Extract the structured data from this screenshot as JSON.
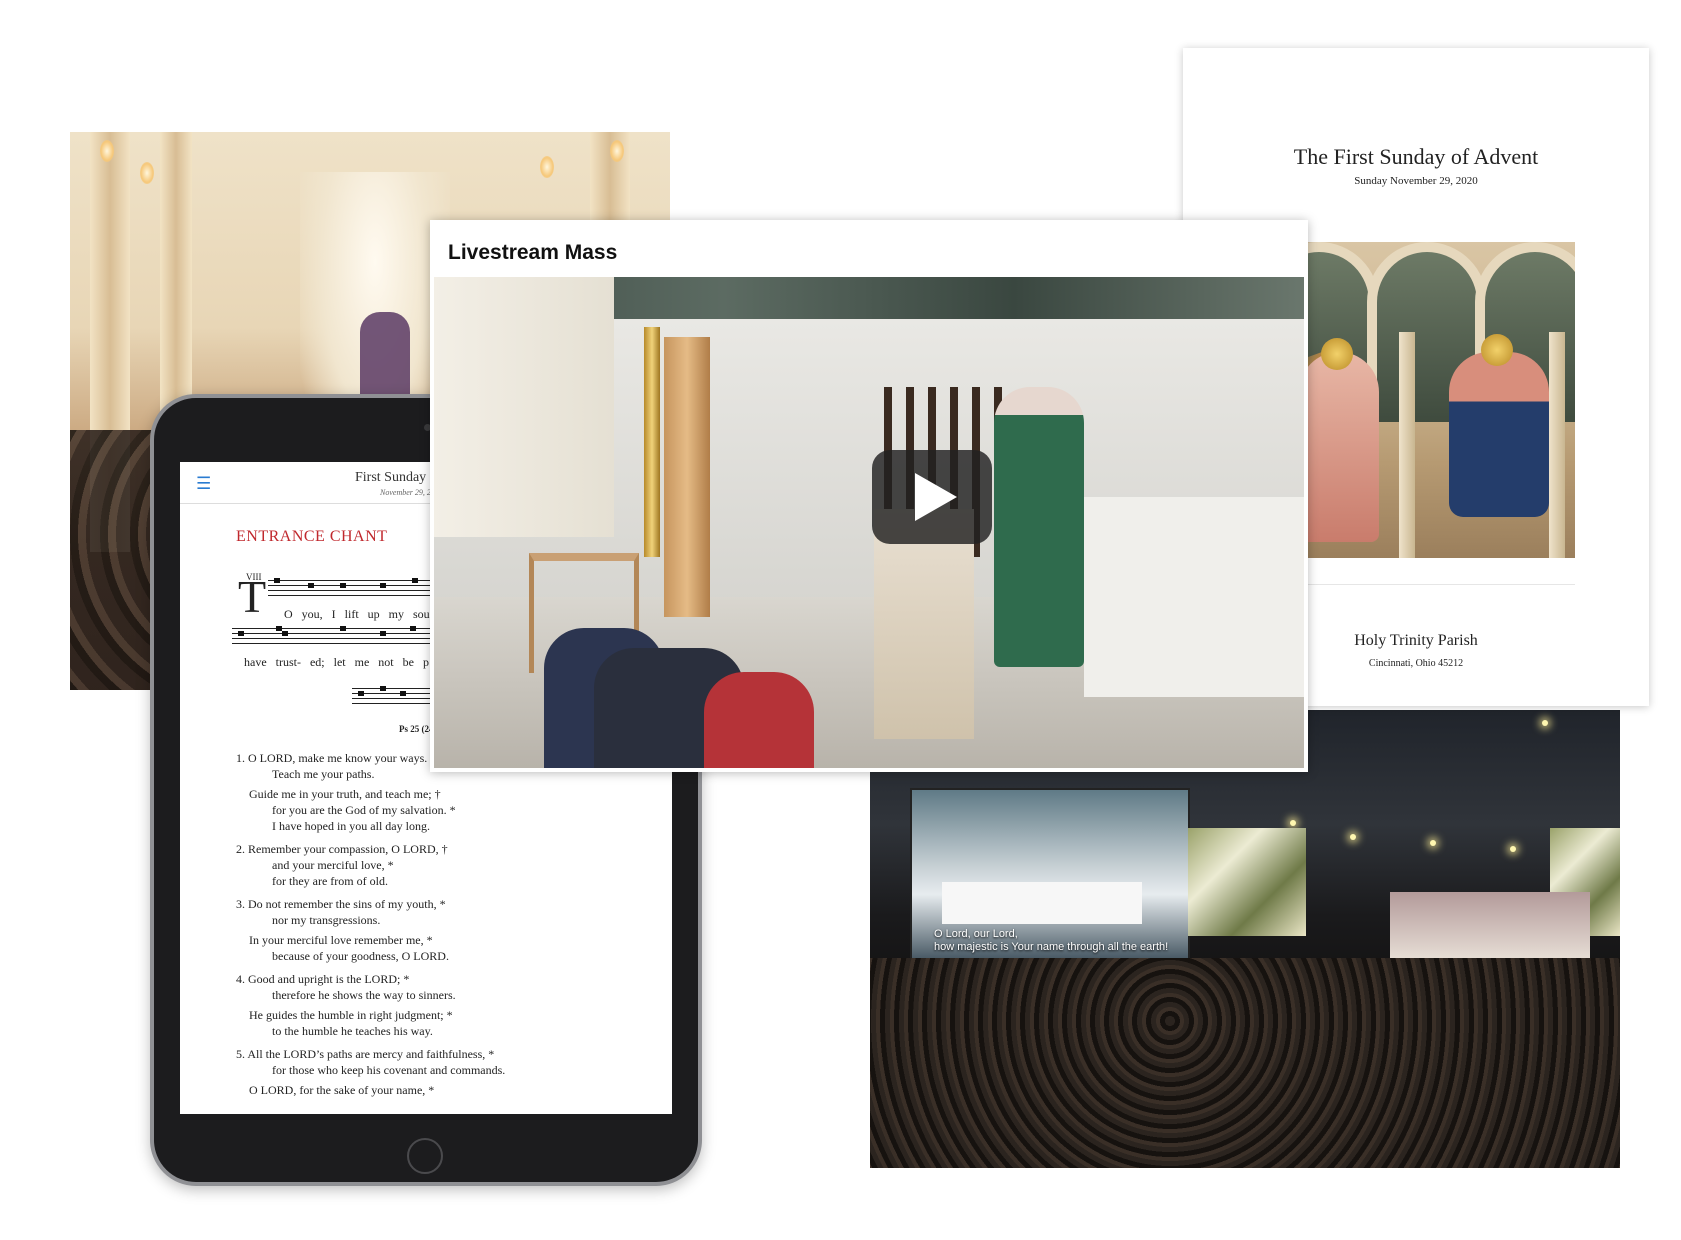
{
  "livestream": {
    "title": "Livestream Mass"
  },
  "bulletin": {
    "title": "The First Sunday of Advent",
    "date": "Sunday November 29, 2020",
    "parish": "Holy Trinity Parish",
    "address": "Cincinnati, Ohio 45212"
  },
  "tablet": {
    "menu_icon": "menu-icon",
    "doc_title": "First Sunday o",
    "doc_date": "November 29, 20",
    "section_heading": "ENTRANCE CHANT",
    "mode": "VIII",
    "initial": "T",
    "chant_line1": "O  you,  I  lift  up  my  sou",
    "chant_line2": "have  trust- ed;     let  me  not  be  p",
    "psalm_ref": "Ps 25 (24):",
    "verses": [
      {
        "n": "1. O LORD, make me know your ways. *",
        "a": "Teach me your paths.",
        "b": "Guide me in your truth, and teach me; †",
        "c": "for you are the God of my salvation. *",
        "d": "I have hoped in you all day long."
      },
      {
        "n": "2. Remember your compassion, O LORD, †",
        "a": "and your merciful love, *",
        "b": "for they are from of old."
      },
      {
        "n": "3. Do not remember the sins of my youth, *",
        "a": "nor my transgressions.",
        "b": "In your merciful love remember me, *",
        "c": "because of your goodness, O LORD."
      },
      {
        "n": "4. Good and upright is the LORD; *",
        "a": "therefore he shows the way to sinners.",
        "b": "He guides the humble in right judgment; *",
        "c": "to the humble he teaches his way."
      },
      {
        "n": "5. All the LORD’s paths are mercy and faithfulness, *",
        "a": "for those who keep his covenant and commands.",
        "b": "O LORD, for the sake of your name, *"
      }
    ]
  },
  "arena": {
    "caption_line1": "O Lord, our Lord,",
    "caption_line2": "how majestic is Your name through all the earth!"
  }
}
